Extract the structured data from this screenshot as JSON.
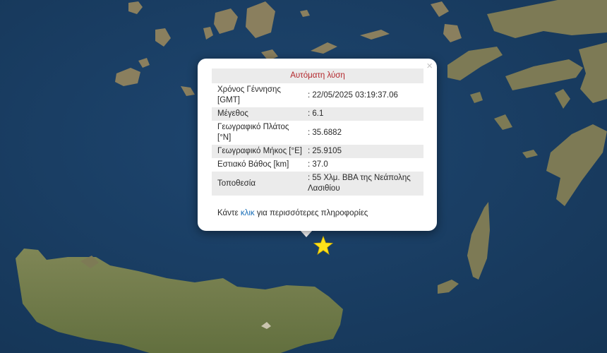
{
  "popup": {
    "close_label": "×",
    "title": "Αυτόματη λύση",
    "rows": [
      {
        "label": "Χρόνος Γέννησης [GMT]",
        "value": ": 22/05/2025 03:19:37.06"
      },
      {
        "label": "Μέγεθος",
        "value": ": 6.1"
      },
      {
        "label": "Γεωγραφικό Πλάτος [°N]",
        "value": ": 35.6882"
      },
      {
        "label": "Γεωγραφικό Μήκος [°E]",
        "value": ": 25.9105"
      },
      {
        "label": "Εστιακό Βάθος [km]",
        "value": ": 37.0"
      },
      {
        "label": "Τοποθεσία",
        "value": ": 55 Χλμ. ΒΒΑ της Νεάπολης Λασιθίου"
      }
    ],
    "footer_prefix": "Κάντε",
    "footer_link": "κλικ",
    "footer_suffix": "για περισσότερες πληροφορίες"
  },
  "map": {
    "sea_color": "#1b3f66",
    "land_color": "#6f7a4a",
    "marker": "star-icon",
    "marker_color": "#ffe21a"
  }
}
